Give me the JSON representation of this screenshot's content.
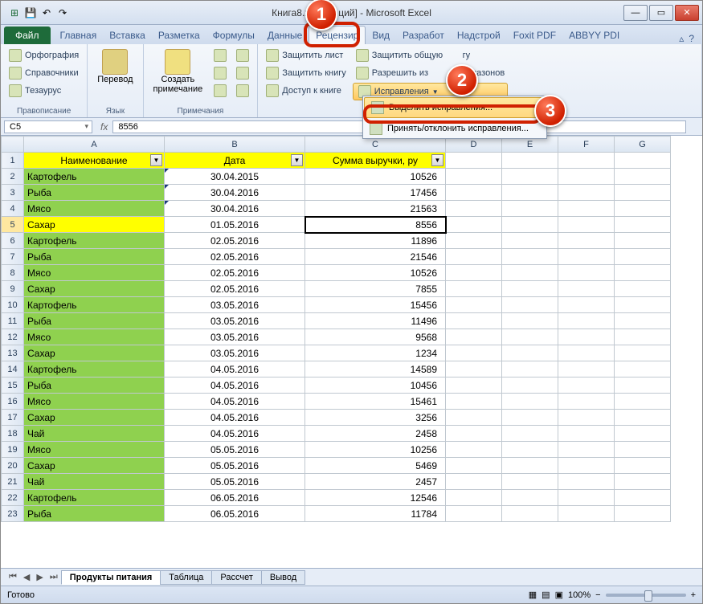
{
  "window": {
    "title_prefix": "Книга8.x",
    "title_suffix": "ций]  -  Microsoft Excel",
    "qat": {
      "save": "💾",
      "undo": "↶",
      "redo": "↷"
    },
    "buttons": {
      "min": "—",
      "max": "▭",
      "close": "✕"
    }
  },
  "tabs": {
    "file": "Файл",
    "items": [
      "Главная",
      "Вставка",
      "Разметка",
      "Формулы",
      "Данные",
      "Рецензир",
      "Вид",
      "Разработ",
      "Надстрой",
      "Foxit PDF",
      "ABBYY PDI"
    ],
    "active_index": 5
  },
  "ribbon": {
    "g1": {
      "spell": "Орфография",
      "ref": "Справочники",
      "thes": "Тезаурус",
      "label": "Правописание"
    },
    "g2": {
      "translate": "Перевод",
      "label": "Язык"
    },
    "g3": {
      "new_comment": "Создать\nпримечание",
      "label": "Примечания"
    },
    "g4": {
      "protect_sheet": "Защитить лист",
      "protect_book": "Защитить книгу",
      "share_book": "Доступ к книге",
      "protect_share": "Защитить общую",
      "allow_ranges": "Разрешить из",
      "ranges_suffix": "диапазонов",
      "track": "Исправления"
    },
    "dropdown": {
      "highlight": "Выделить исправления...",
      "accept": "Принять/отклонить исправления..."
    }
  },
  "namebox": {
    "cell": "C5",
    "fx": "fx",
    "formula": "8556"
  },
  "columns": [
    "A",
    "B",
    "C",
    "D",
    "E",
    "F",
    "G"
  ],
  "headers": {
    "a": "Наименование",
    "b": "Дата",
    "c": "Сумма выручки, ру"
  },
  "rows": [
    {
      "n": 2,
      "a": "Картофель",
      "b": "30.04.2015",
      "c": "10526",
      "track": true
    },
    {
      "n": 3,
      "a": "Рыба",
      "b": "30.04.2016",
      "c": "17456",
      "track": true
    },
    {
      "n": 4,
      "a": "Мясо",
      "b": "30.04.2016",
      "c": "21563",
      "track": true
    },
    {
      "n": 5,
      "a": "Сахар",
      "b": "01.05.2016",
      "c": "8556",
      "active": true,
      "selected": true
    },
    {
      "n": 6,
      "a": "Картофель",
      "b": "02.05.2016",
      "c": "11896"
    },
    {
      "n": 7,
      "a": "Рыба",
      "b": "02.05.2016",
      "c": "21546"
    },
    {
      "n": 8,
      "a": "Мясо",
      "b": "02.05.2016",
      "c": "10526"
    },
    {
      "n": 9,
      "a": "Сахар",
      "b": "02.05.2016",
      "c": "7855"
    },
    {
      "n": 10,
      "a": "Картофель",
      "b": "03.05.2016",
      "c": "15456"
    },
    {
      "n": 11,
      "a": "Рыба",
      "b": "03.05.2016",
      "c": "11496"
    },
    {
      "n": 12,
      "a": "Мясо",
      "b": "03.05.2016",
      "c": "9568"
    },
    {
      "n": 13,
      "a": "Сахар",
      "b": "03.05.2016",
      "c": "1234"
    },
    {
      "n": 14,
      "a": "Картофель",
      "b": "04.05.2016",
      "c": "14589"
    },
    {
      "n": 15,
      "a": "Рыба",
      "b": "04.05.2016",
      "c": "10456"
    },
    {
      "n": 16,
      "a": "Мясо",
      "b": "04.05.2016",
      "c": "15461"
    },
    {
      "n": 17,
      "a": "Сахар",
      "b": "04.05.2016",
      "c": "3256"
    },
    {
      "n": 18,
      "a": "Чай",
      "b": "04.05.2016",
      "c": "2458"
    },
    {
      "n": 19,
      "a": "Мясо",
      "b": "05.05.2016",
      "c": "10256"
    },
    {
      "n": 20,
      "a": "Сахар",
      "b": "05.05.2016",
      "c": "5469"
    },
    {
      "n": 21,
      "a": "Чай",
      "b": "05.05.2016",
      "c": "2457"
    },
    {
      "n": 22,
      "a": "Картофель",
      "b": "06.05.2016",
      "c": "12546"
    },
    {
      "n": 23,
      "a": "Рыба",
      "b": "06.05.2016",
      "c": "11784"
    }
  ],
  "sheets": {
    "nav": [
      "⏮",
      "◀",
      "▶",
      "⏭"
    ],
    "tabs": [
      "Продукты питания",
      "Таблица",
      "Рассчет",
      "Вывод"
    ],
    "active": 0
  },
  "status": {
    "ready": "Готово",
    "zoom": "100%",
    "minus": "−",
    "plus": "+"
  },
  "callouts": {
    "c1": "1",
    "c2": "2",
    "c3": "3"
  }
}
